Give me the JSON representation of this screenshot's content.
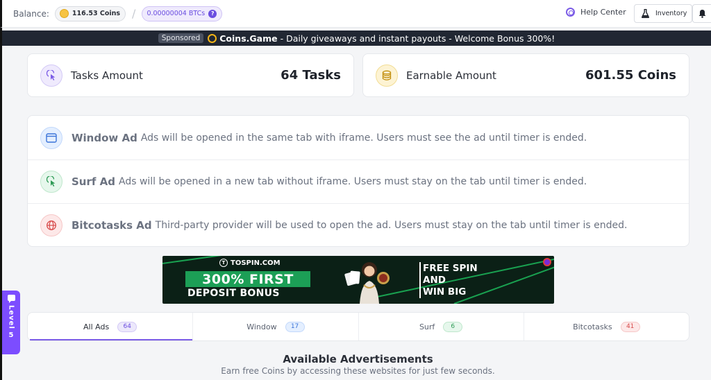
{
  "topbar": {
    "balance_label": "Balance:",
    "coins": "116.53 Coins",
    "btc": "0.00000004 BTCs",
    "btc_help": "?",
    "help_center": "Help Center",
    "inventory": "Inventory"
  },
  "sponsor": {
    "tag": "Sponsored",
    "brand": "Coins.Game",
    "text": "- Daily giveaways and instant payouts - Welcome Bonus 300%!"
  },
  "stats": {
    "tasks_label": "Tasks Amount",
    "tasks_value": "64 Tasks",
    "earn_label": "Earnable Amount",
    "earn_value": "601.55 Coins"
  },
  "ad_types": [
    {
      "name": "Window Ad",
      "desc": "Ads will be opened in the same tab with iframe. Users must see the ad until timer is ended.",
      "icon": "window-icon",
      "color": "#3a73d8"
    },
    {
      "name": "Surf Ad",
      "desc": "Ads will be opened in a new tab without iframe. Users must stay on the tab until timer is ended.",
      "icon": "cursor-click-icon",
      "color": "#2e9a55"
    },
    {
      "name": "Bitcotasks Ad",
      "desc": "Third-party provider will be used to open the ad. Users must stay on the tab until timer is ended.",
      "icon": "globe-icon",
      "color": "#d74a4a"
    }
  ],
  "banner": {
    "brand": "TOSPIN.COM",
    "headline": "300% FIRST",
    "subline": "DEPOSIT BONUS",
    "right_line1": "FREE SPIN",
    "right_line2": "AND",
    "right_line3": "WIN BIG"
  },
  "tabs": [
    {
      "label": "All Ads",
      "count": "64"
    },
    {
      "label": "Window",
      "count": "17"
    },
    {
      "label": "Surf",
      "count": "6"
    },
    {
      "label": "Bitcotasks",
      "count": "41"
    }
  ],
  "available": {
    "title": "Available Advertisements",
    "subtitle": "Earn free Coins by accessing these websites for just few seconds."
  },
  "level": {
    "label": "Level",
    "number": "5"
  },
  "colors": {
    "accent": "#7b5ce6",
    "sponsor_bg": "#212733",
    "level_bg": "#7c4dff"
  }
}
